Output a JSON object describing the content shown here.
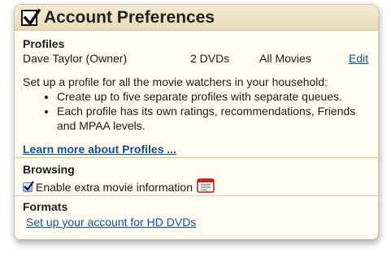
{
  "panel": {
    "title": "Account Preferences",
    "title_checked": true
  },
  "profiles": {
    "heading": "Profiles",
    "row": {
      "name": "Dave Taylor (Owner)",
      "dvds": "2 DVDs",
      "movies": "All Movies",
      "edit": "Edit"
    },
    "description": "Set up a profile for all the movie watchers in your household:",
    "bullets": [
      "Create up to five separate profiles with separate queues.",
      "Each profile has its own ratings, recommendations, Friends and MPAA levels."
    ],
    "learn_more": "Learn more about Profiles ..."
  },
  "browsing": {
    "heading": "Browsing",
    "option_label": "Enable extra movie information",
    "option_checked": true,
    "info_icon": "movie-info-icon"
  },
  "formats": {
    "heading": "Formats",
    "link": "Set up your account for HD DVDs"
  },
  "colors": {
    "link": "#1b4b93",
    "header_bg": "#efe4c4",
    "panel_bg": "#fffdf2",
    "divider": "#d8c9a3"
  }
}
